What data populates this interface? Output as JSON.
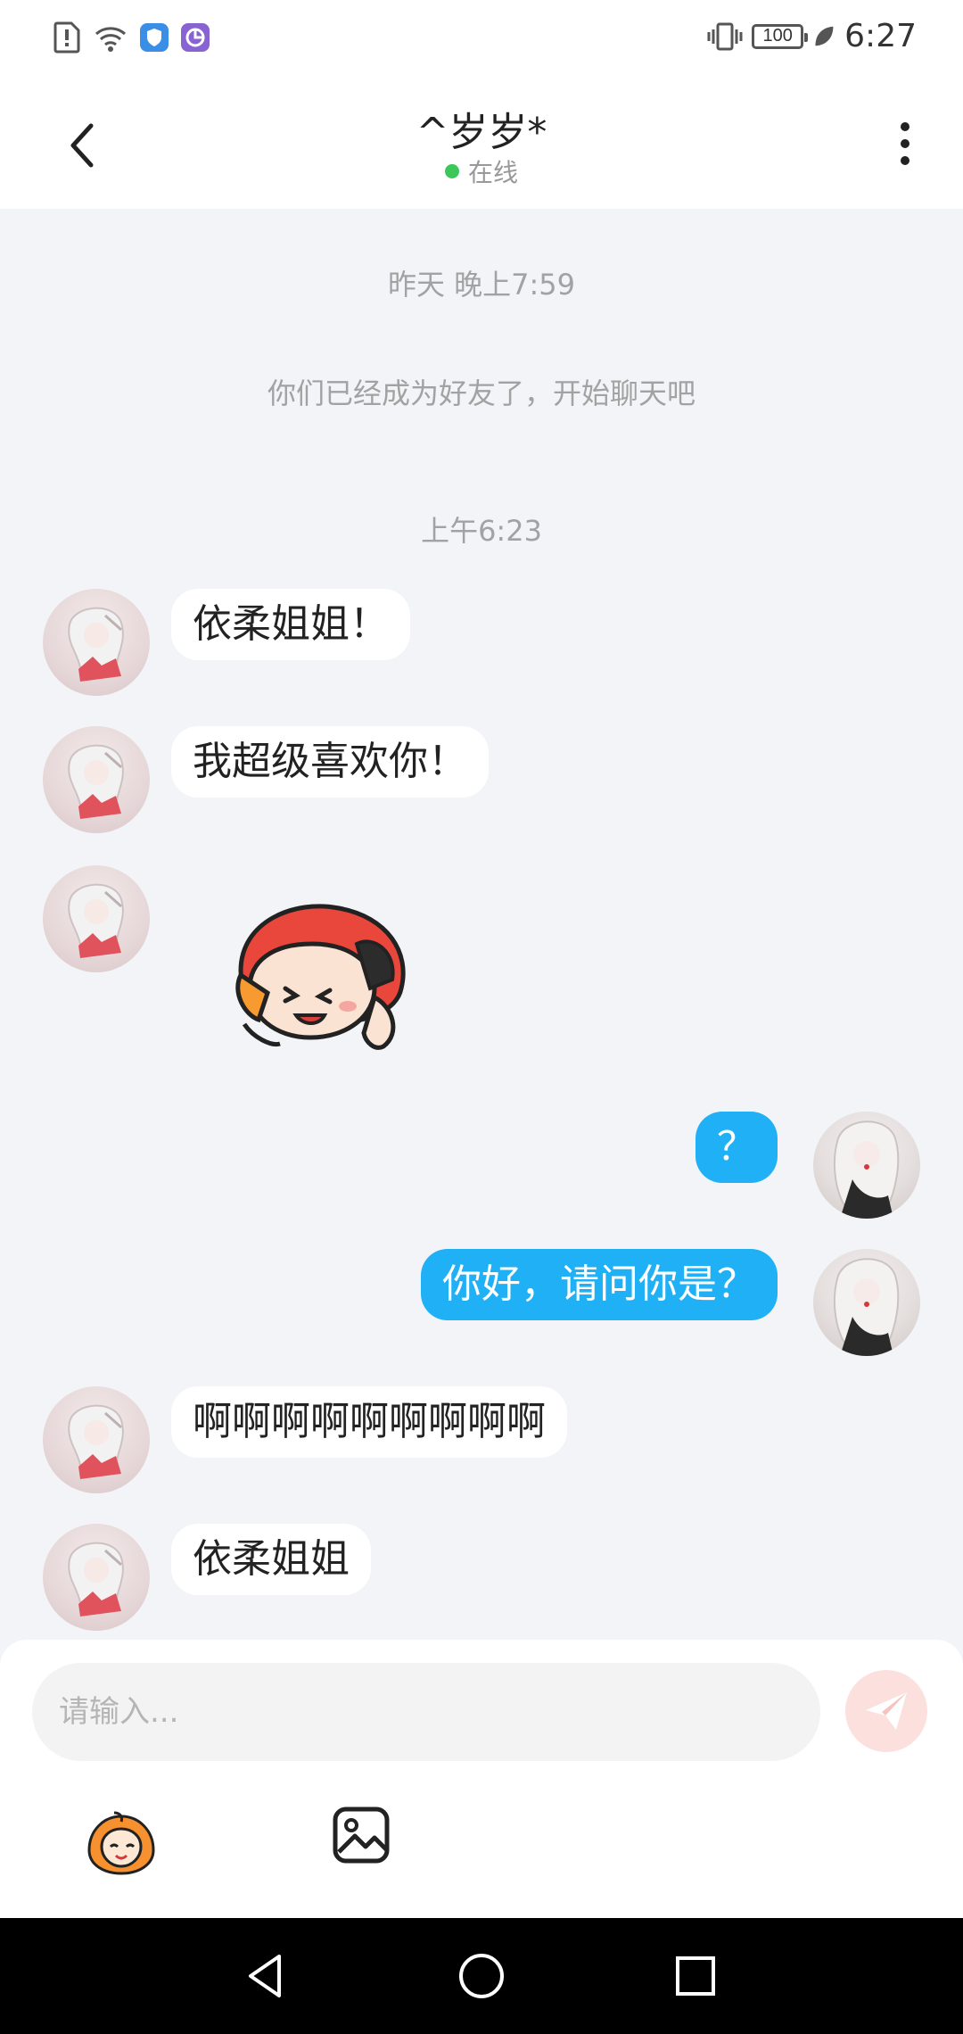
{
  "status_bar": {
    "time": "6:27",
    "battery": "100"
  },
  "header": {
    "title": "^岁岁*",
    "presence": "在线"
  },
  "chat": {
    "system": {
      "date_divider": "昨天 晚上7:59",
      "friend_notice": "你们已经成为好友了，开始聊天吧",
      "time_divider": "上午6:23"
    },
    "messages": [
      {
        "side": "in",
        "text": "依柔姐姐！"
      },
      {
        "side": "in",
        "text": "我超级喜欢你！"
      },
      {
        "side": "in",
        "type": "sticker"
      },
      {
        "side": "out",
        "text": "？"
      },
      {
        "side": "out",
        "text": "你好，请问你是？"
      },
      {
        "side": "in",
        "text": "啊啊啊啊啊啊啊啊啊"
      },
      {
        "side": "in",
        "text": "依柔姐姐"
      }
    ]
  },
  "composer": {
    "placeholder": "请输入..."
  },
  "icons": {
    "back": "chevron-left-icon",
    "more": "more-vertical-icon",
    "send": "paper-plane-icon",
    "emoji": "emoji-sticker-icon",
    "image": "image-icon",
    "nav_back": "triangle-back-icon",
    "nav_home": "circle-home-icon",
    "nav_recent": "square-recent-icon"
  },
  "colors": {
    "outgoing_bubble": "#1fb0f5",
    "online": "#3cc75a",
    "send_button": "#fbe0de"
  }
}
